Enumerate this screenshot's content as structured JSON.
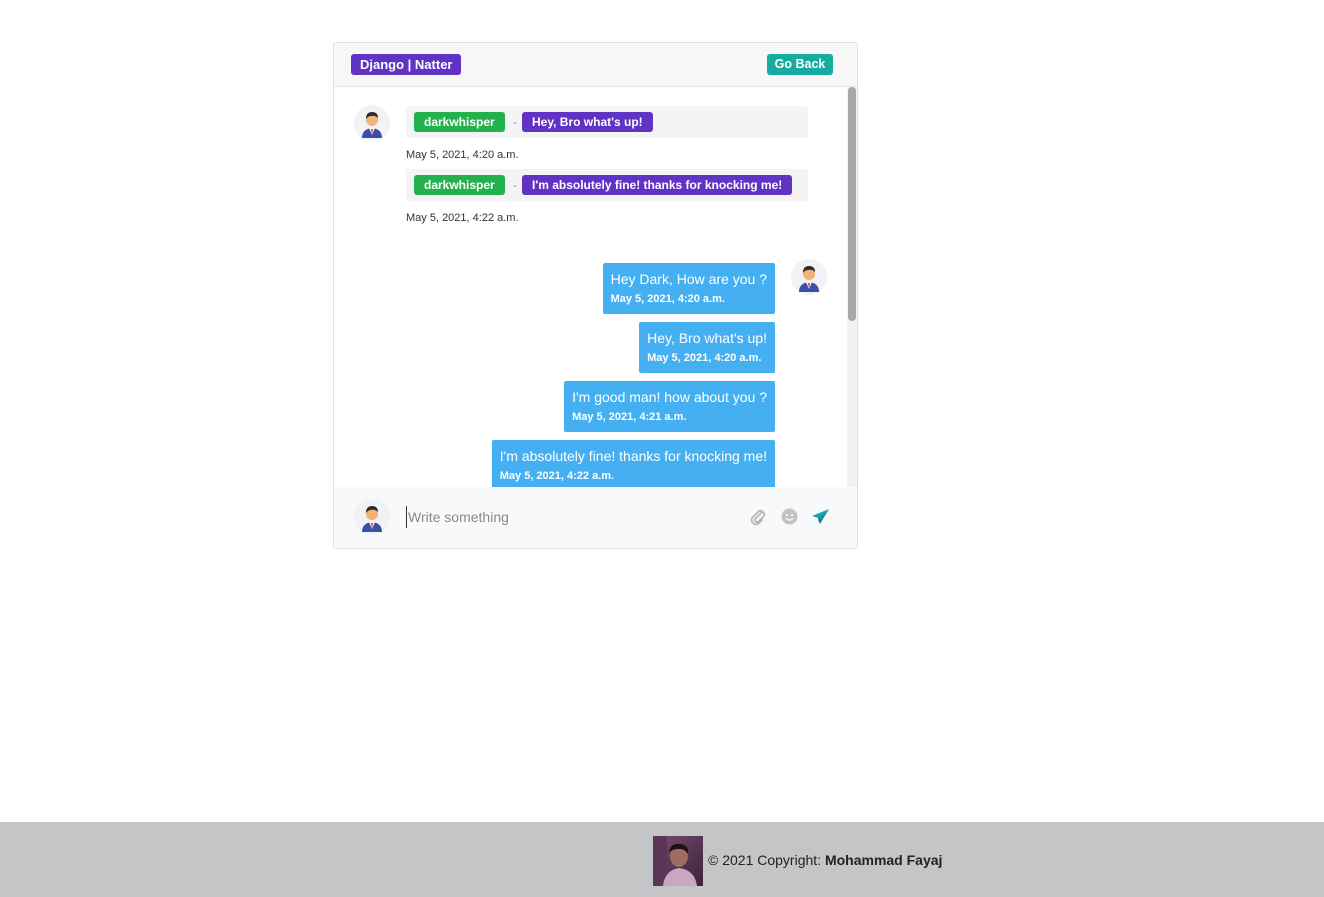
{
  "header": {
    "brand": "Django | Natter",
    "back_label": "Go Back"
  },
  "received": [
    {
      "user": "darkwhisper",
      "separator": "-",
      "message": "Hey, Bro what's up!",
      "time": "May 5, 2021, 4:20 a.m."
    },
    {
      "user": "darkwhisper",
      "separator": "-",
      "message": "I'm absolutely fine! thanks for knocking me!",
      "time": "May 5, 2021, 4:22 a.m."
    }
  ],
  "sent": [
    {
      "text": "Hey Dark, How are you ?",
      "time": "May 5, 2021, 4:20 a.m."
    },
    {
      "text": "Hey, Bro what's up!",
      "time": "May 5, 2021, 4:20 a.m."
    },
    {
      "text": "I'm good man! how about you ?",
      "time": "May 5, 2021, 4:21 a.m."
    },
    {
      "text": "I'm absolutely fine! thanks for knocking me!",
      "time": "May 5, 2021, 4:22 a.m."
    }
  ],
  "composer": {
    "value": "",
    "placeholder": "Write something",
    "icons": [
      "paperclip-icon",
      "smiley-icon",
      "send-icon"
    ]
  },
  "footer": {
    "copyright": "© 2021 Copyright:",
    "author": "Mohammad Fayaj"
  },
  "colors": {
    "brand_purple": "#6133c4",
    "user_green": "#23b14d",
    "back_teal": "#16aca1",
    "sent_blue": "#44b0f2",
    "footer_gray": "#c4c5c7"
  }
}
